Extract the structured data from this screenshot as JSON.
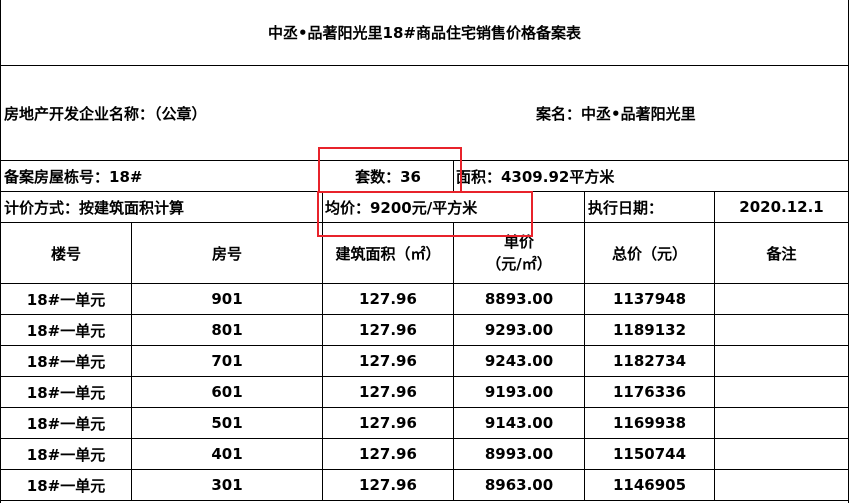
{
  "title": "中丞•品著阳光里18#商品住宅销售价格备案表",
  "developer_label": "房地产开发企业名称：（公章）",
  "project_label": "案名：中丞•品著阳光里",
  "building_label": "备案房屋栋号：18#",
  "units_label": "套数：36",
  "area_label": "面积：4309.92平方米",
  "pricing_method": "计价方式：按建筑面积计算",
  "avg_price": "均价：9200元/平方米",
  "exec_date_label": "执行日期：",
  "exec_date": "2020.12.1",
  "headers": {
    "building": "楼号",
    "room": "房号",
    "area": "建筑面积（㎡）",
    "unit_price_line1": "单价",
    "unit_price_line2": "（元/㎡）",
    "total": "总价（元）",
    "remark": "备注"
  },
  "rows": [
    {
      "building": "18#一单元",
      "room": "901",
      "area": "127.96",
      "unit_price": "8893.00",
      "total": "1137948",
      "remark": ""
    },
    {
      "building": "18#一单元",
      "room": "801",
      "area": "127.96",
      "unit_price": "9293.00",
      "total": "1189132",
      "remark": ""
    },
    {
      "building": "18#一单元",
      "room": "701",
      "area": "127.96",
      "unit_price": "9243.00",
      "total": "1182734",
      "remark": ""
    },
    {
      "building": "18#一单元",
      "room": "601",
      "area": "127.96",
      "unit_price": "9193.00",
      "total": "1176336",
      "remark": ""
    },
    {
      "building": "18#一单元",
      "room": "501",
      "area": "127.96",
      "unit_price": "9143.00",
      "total": "1169938",
      "remark": ""
    },
    {
      "building": "18#一单元",
      "room": "401",
      "area": "127.96",
      "unit_price": "8993.00",
      "total": "1150744",
      "remark": ""
    },
    {
      "building": "18#一单元",
      "room": "301",
      "area": "127.96",
      "unit_price": "8963.00",
      "total": "1146905",
      "remark": ""
    }
  ],
  "highlight_color": "#e8232b"
}
